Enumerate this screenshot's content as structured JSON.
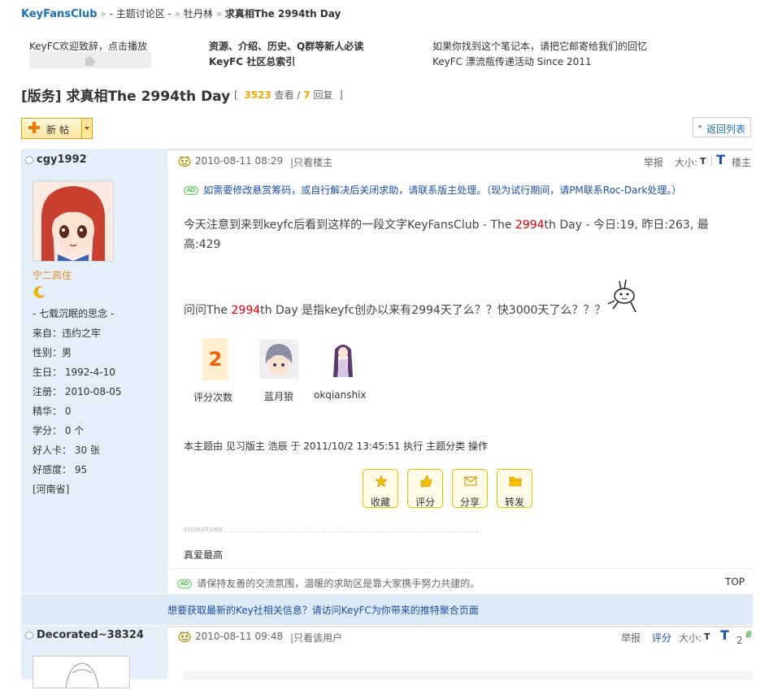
{
  "breadcrumb": {
    "home": "KeyFansClub",
    "sep1": "»",
    "forum": "- 主题讨论区 -",
    "sep2": "»",
    "board": "牡丹林",
    "sep3": "»",
    "current": "求真相The 2994th Day"
  },
  "toplinks": {
    "col1_line1": "KeyFC欢迎致辞，点击播放",
    "col2_line1": "资源、介绍、历史、Q群等新人必读",
    "col2_line2": "KeyFC 社区总索引",
    "col3_line1": "如果你找到这个笔记本，请把它邮寄给我们的回忆",
    "col3_line2": "KeyFC 漂流瓶传递活动 Since 2011"
  },
  "thread": {
    "title": "[版务] 求真相The 2994th Day",
    "bracket_open": "[",
    "views": "3523",
    "views_label": "查看 /",
    "replies": "7",
    "replies_label": "回复",
    "bracket_close": "]"
  },
  "buttons": {
    "new_post": "新帖",
    "back_to_list": "返回列表"
  },
  "post1": {
    "username": "cgy1992",
    "title_text": "宁二高住",
    "motto": "- 七载沉眠的思念 -",
    "from": "来自：违约之牢",
    "gender": "性别：男",
    "birthday": "生日：  1992-4-10",
    "registered": "注册：  2010-08-05",
    "essence": "精华：  0",
    "credits": "学分：  0 个",
    "cards": "好人卡：  30 张",
    "favor": "好感度：  95",
    "province": "[河南省]",
    "date": "2010-08-11 08:29",
    "view_author_only": "|只看楼主",
    "report": "举报",
    "font_size_label": "大小:",
    "font_small": "T",
    "font_large": "T",
    "floor": "楼主",
    "notice": "如需要修改悬赏筹码，或自行解决后关闭求助，请联系版主处理。（现为试行期间，请PM联系Roc-Dark处理。）",
    "ad_tag": "AD",
    "line1_a": "今天注意到来到keyfc后看到这样的一段文字KeyFansClub - The ",
    "line1_red": "2994",
    "line1_b": "th Day - 今日:19, 昨日:263, 最",
    "line2": "高:429",
    "line3_a": "问问The ",
    "line3_red": "2994",
    "line3_b": "th Day 是指keyfc创办以来有2994天了么？？快3000天了么？？？",
    "rate_count": "2",
    "rate_label": "评分次数",
    "rater1": "蓝月狼",
    "rater2": "okqianshix",
    "mod_note": "本主题由 见习版主 浩辰 于 2011/10/2 13:45:51 执行 主题分类 操作",
    "actions": [
      "收藏",
      "评分",
      "分享",
      "转发"
    ],
    "signature_label": "SIGNATURE:",
    "signature": "真爱最高",
    "footer_notice": "请保持友善的交流氛围，温暖的求助区是靠大家携手努力共建的。",
    "top": "TOP"
  },
  "bottom_bar": {
    "link": "想要获取最新的Key社相关信息？请访问KeyFC为你带来的推特聚合页面"
  },
  "post2": {
    "username": "Decorated~38324",
    "date": "2010-08-11 09:48",
    "view_author_only": "|只看该用户",
    "report": "举报",
    "rate": "评分",
    "font_size_label": "大小:",
    "font_small": "T",
    "font_large": "T",
    "floor_num": "2",
    "floor_mark": "#"
  },
  "colors": {
    "link_blue": "#1d6fb3",
    "notice_blue": "#1d4faa",
    "sidebar_bg": "#e5eff9",
    "accent_orange": "#f0a800",
    "highlight_red": "#d00000"
  },
  "icons": {
    "post_icon": "smiley-icon",
    "rank_icon": "moon-icon",
    "online": "status-circle-icon",
    "puzzle": "puzzle-icon"
  }
}
